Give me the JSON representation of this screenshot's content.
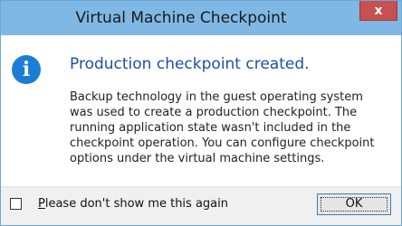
{
  "window": {
    "title": "Virtual Machine Checkpoint",
    "close_symbol": "x"
  },
  "message": {
    "icon": "info-icon",
    "heading": "Production checkpoint created.",
    "body": "Backup technology in the guest operating system was used to create a production checkpoint. The running application state wasn't included in the checkpoint operation. You can configure checkpoint options under the virtual machine settings."
  },
  "footer": {
    "checkbox_label": "Please don't show me this again",
    "checkbox_checked": false,
    "ok_label": "OK"
  },
  "colors": {
    "titlebar": "#7fb8e4",
    "close_button": "#c75050",
    "heading": "#1f4ea8",
    "info_icon": "#1b7ed6"
  }
}
